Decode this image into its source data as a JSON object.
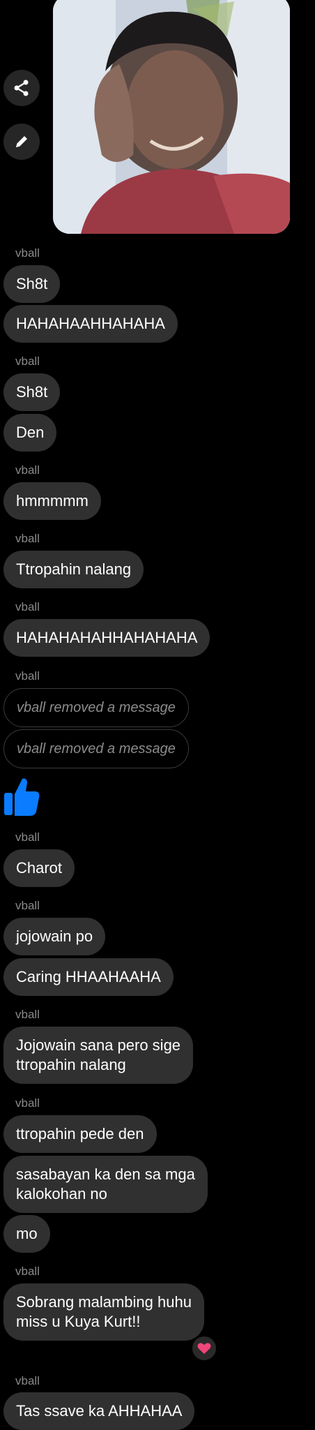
{
  "sender_name": "vball",
  "icons": {
    "share": "share-icon",
    "edit": "pencil-icon",
    "like": "thumbs-up-icon",
    "reaction": "heart-icon"
  },
  "colors": {
    "background": "#000000",
    "bubble": "#303030",
    "like_blue": "#0a7cff",
    "heart": "#f0467a"
  },
  "messages": [
    {
      "sender": "vball",
      "text": "Sh8t"
    },
    {
      "text": "HAHAHAAHHAHAHA"
    },
    {
      "sender": "vball",
      "text": "Sh8t"
    },
    {
      "text": "Den"
    },
    {
      "sender": "vball",
      "text": "hmmmmm"
    },
    {
      "sender": "vball",
      "text": "Ttropahin nalang"
    },
    {
      "sender": "vball",
      "text": "HAHAHAHAHHAHAHAHA"
    },
    {
      "sender": "vball",
      "text": "vball removed a message"
    },
    {
      "text": "vball removed a message"
    },
    {
      "sender": "vball",
      "text": "Charot"
    },
    {
      "sender": "vball",
      "text": "jojowain po"
    },
    {
      "text": "Caring HHAAHAAHA"
    },
    {
      "sender": "vball",
      "text": "Jojowain sana pero sige\nttropahin nalang"
    },
    {
      "sender": "vball",
      "text": "ttropahin pede den"
    },
    {
      "text": "sasabayan ka den sa mga\nkalokohan no"
    },
    {
      "text": "mo"
    },
    {
      "sender": "vball",
      "text": "Sobrang malambing huhu\nmiss u Kuya Kurt!!"
    },
    {
      "sender": "vball",
      "text": "Tas ssave ka AHHAHAA"
    }
  ]
}
